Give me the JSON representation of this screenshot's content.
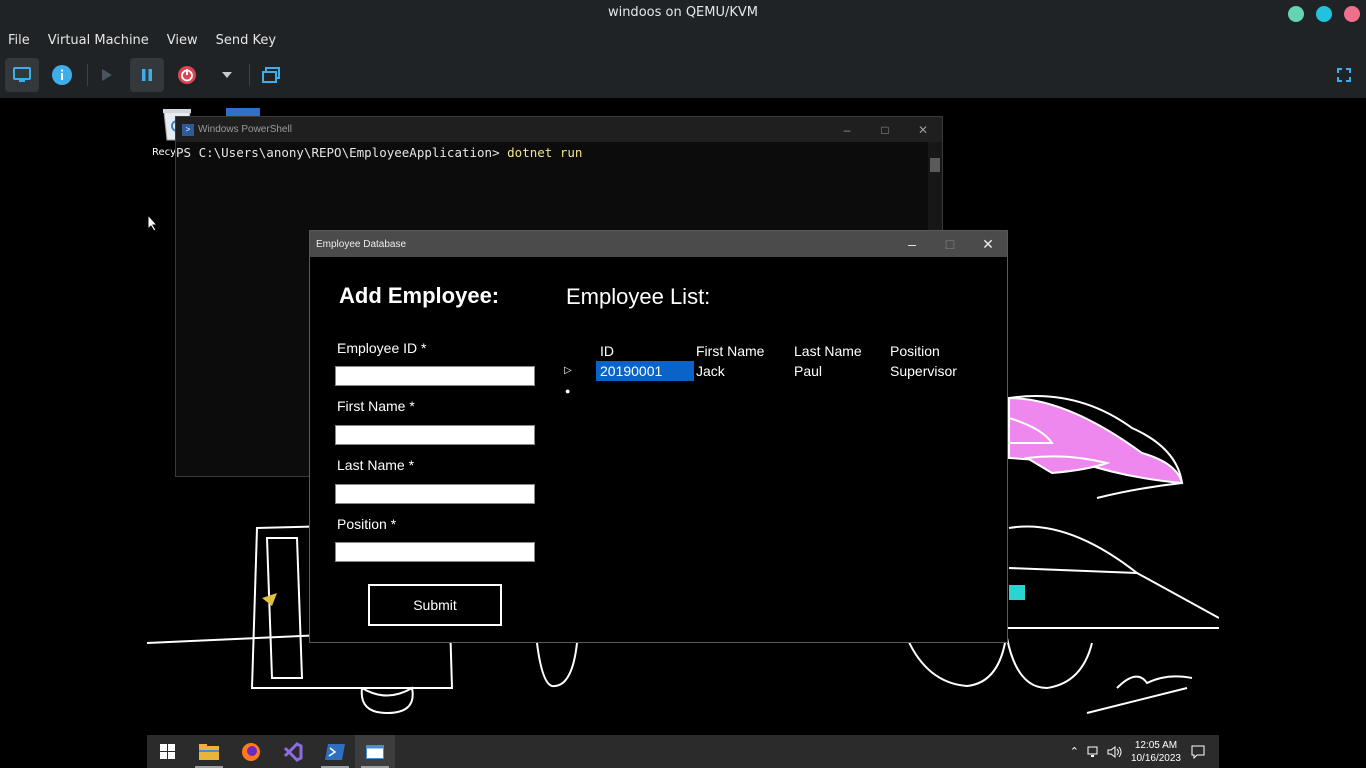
{
  "host": {
    "title": "windoos on QEMU/KVM",
    "title_dots": [
      {
        "name": "minimize",
        "color": "#64d4b4"
      },
      {
        "name": "maximize",
        "color": "#22c1de"
      },
      {
        "name": "close",
        "color": "#f06f8b"
      }
    ],
    "menu": [
      "File",
      "Virtual Machine",
      "View",
      "Send Key"
    ],
    "toolbar": {
      "icons": [
        "monitor-icon",
        "info-icon",
        "play-icon",
        "pause-icon",
        "power-icon",
        "dropdown-icon",
        "clone-icon",
        "fullscreen-icon"
      ],
      "colors": {
        "info": "#3daee9",
        "power": "#da4453",
        "accent": "#3daee9"
      }
    }
  },
  "desktop": {
    "recycle_label": "Recy"
  },
  "powershell": {
    "title": "Windows PowerShell",
    "prompt": "PS C:\\Users\\anony\\REPO\\EmployeeApplication> ",
    "command": "dotnet run"
  },
  "app": {
    "title": "Employee Database",
    "add_title": "Add Employee:",
    "fields": [
      {
        "label": "Employee ID *",
        "value": ""
      },
      {
        "label": "First Name *",
        "value": ""
      },
      {
        "label": "Last Name *",
        "value": ""
      },
      {
        "label": "Position *",
        "value": ""
      }
    ],
    "submit_label": "Submit",
    "list_title": "Employee List:",
    "columns": [
      "ID",
      "First Name",
      "Last Name",
      "Position"
    ],
    "rows": [
      {
        "id": "20190001",
        "first": "Jack",
        "last": "Paul",
        "position": "Supervisor"
      }
    ],
    "selection_color": "#0a64c8"
  },
  "taskbar": {
    "apps": [
      "windows-start-icon",
      "file-explorer-icon",
      "firefox-icon",
      "visual-studio-icon",
      "powershell-icon",
      "app-window-icon"
    ],
    "time": "12:05 AM",
    "date": "10/16/2023"
  }
}
